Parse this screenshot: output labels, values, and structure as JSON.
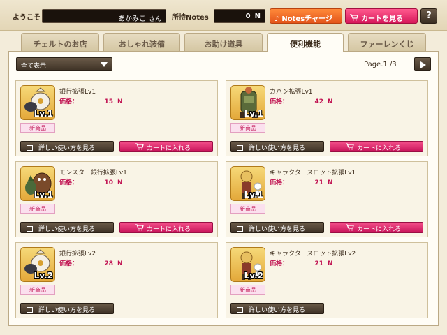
{
  "header": {
    "welcome": "ようこそ",
    "username": "あかみこ",
    "username_suffix": "さん",
    "notes_label": "所持Notes",
    "notes_value": "0",
    "notes_unit": "N",
    "charge_label": "Notesチャージ",
    "cart_label": "カートを見る",
    "help_label": "?"
  },
  "tabs": [
    {
      "label": "チェルトのお店",
      "active": false
    },
    {
      "label": "おしゃれ装備",
      "active": false
    },
    {
      "label": "お助け道具",
      "active": false
    },
    {
      "label": "便利機能",
      "active": true
    },
    {
      "label": "ファーレンくじ",
      "active": false
    }
  ],
  "filter": {
    "selected": "全て表示"
  },
  "pagination": {
    "text": "Page.1 /3"
  },
  "items": [
    {
      "name": "銀行拡張Lv1",
      "price_label": "価格：",
      "price": "15",
      "unit": "N",
      "badge": "新商品",
      "lv": "Lv.1",
      "howto": "詳しい使い方を見る",
      "addcart": "カートに入れる",
      "thumb": "bank-bag-icon"
    },
    {
      "name": "カバン拡張Lv1",
      "price_label": "価格：",
      "price": "42",
      "unit": "N",
      "badge": "新商品",
      "lv": "Lv.1",
      "howto": "詳しい使い方を見る",
      "addcart": "カートに入れる",
      "thumb": "backpack-character-icon"
    },
    {
      "name": "モンスター銀行拡張Lv1",
      "price_label": "価格：",
      "price": "10",
      "unit": "N",
      "badge": "新商品",
      "lv": "Lv.1",
      "howto": "詳しい使い方を見る",
      "addcart": "カートに入れる",
      "thumb": "monster-icon"
    },
    {
      "name": "キャラクタースロット拡張Lv1",
      "price_label": "価格：",
      "price": "21",
      "unit": "N",
      "badge": "新商品",
      "lv": "Lv.1",
      "howto": "詳しい使い方を見る",
      "addcart": "カートに入れる",
      "thumb": "character-icon"
    },
    {
      "name": "銀行拡張Lv2",
      "price_label": "価格：",
      "price": "28",
      "unit": "N",
      "badge": "新商品",
      "lv": "Lv.2",
      "howto": "詳しい使い方を見る",
      "thumb": "bank-bag-icon"
    },
    {
      "name": "キャラクタースロット拡張Lv2",
      "price_label": "価格：",
      "price": "21",
      "unit": "N",
      "badge": "新商品",
      "lv": "Lv.2",
      "howto": "詳しい使い方を見る",
      "thumb": "character-icon"
    }
  ]
}
